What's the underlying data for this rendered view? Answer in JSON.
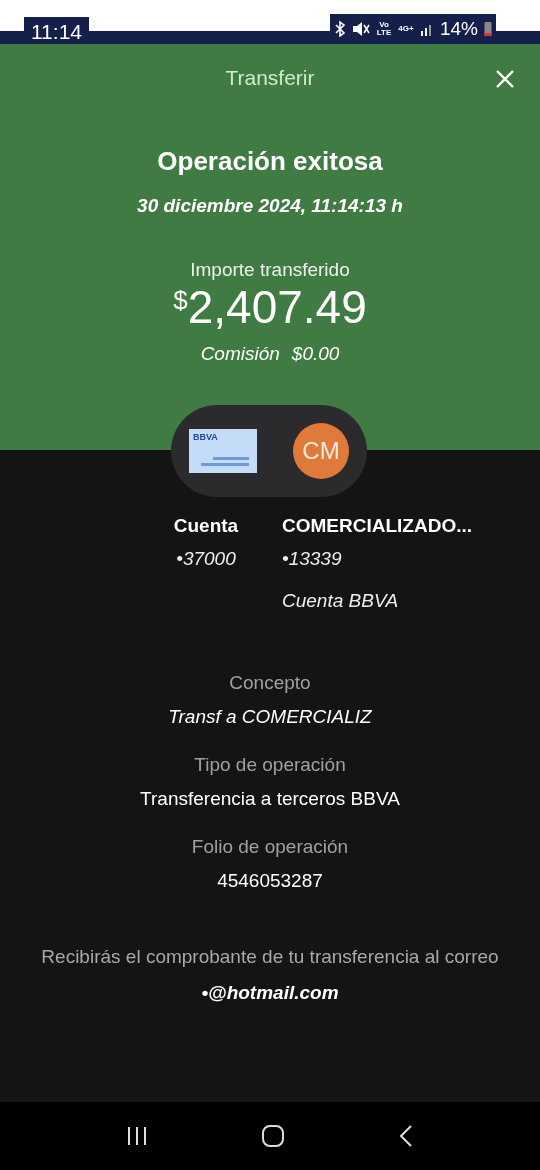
{
  "status_bar": {
    "time": "11:14",
    "volte": "Vo LTE",
    "network": "4G+",
    "battery": "14%"
  },
  "header": {
    "title": "Transferir"
  },
  "result": {
    "title": "Operación exitosa",
    "date": "30 diciembre 2024, 11:14:13 h",
    "amount_label": "Importe transferido",
    "currency": "$",
    "amount": "2,407.49",
    "fee_label": "Comisión",
    "fee": "$0.00"
  },
  "accounts": {
    "card_brand": "BBVA",
    "avatar_initials": "CM",
    "origin": {
      "name": "Cuenta",
      "number": "•37000"
    },
    "destination": {
      "name": "COMERCIALIZADO...",
      "number": "•13339",
      "type": "Cuenta BBVA"
    }
  },
  "details": [
    {
      "label": "Concepto",
      "value": "Transf a COMERCIALIZ",
      "italic": true
    },
    {
      "label": "Tipo de operación",
      "value": "Transferencia a terceros BBVA",
      "italic": false
    },
    {
      "label": "Folio de operación",
      "value": "4546053287",
      "italic": false
    }
  ],
  "notice": {
    "text": "Recibirás el comprobante de tu transferencia al correo",
    "email": "•@hotmail.com"
  }
}
